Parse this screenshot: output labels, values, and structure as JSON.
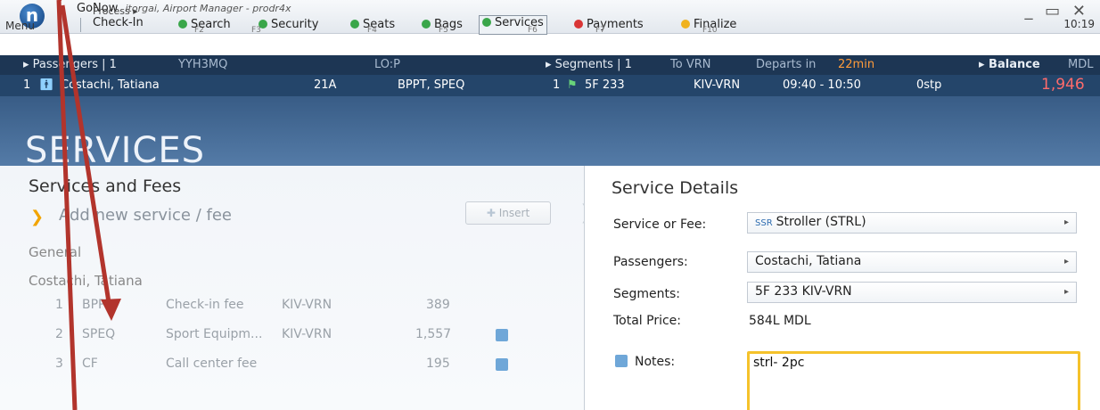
{
  "window": {
    "logo_letter": "n",
    "menu_label": "Menu",
    "app_name": "GoNow",
    "app_sub": "itorgai, Airport Manager - prodr4x",
    "process_label": "Process ▸",
    "current_mode": "Check-In",
    "mode_key": "F2",
    "controls": "_ ▭ ✕",
    "clock": "10:19"
  },
  "steps": [
    {
      "label": "Search",
      "key": "F3",
      "color": "#3aa64a"
    },
    {
      "label": "Security",
      "key": "F4",
      "color": "#3aa64a"
    },
    {
      "label": "Seats",
      "key": "F5",
      "color": "#3aa64a"
    },
    {
      "label": "Bags",
      "key": "F6",
      "color": "#3aa64a"
    },
    {
      "label": "Services",
      "key": "F6",
      "color": "#3aa64a"
    },
    {
      "label": "Payments",
      "key": "F7",
      "color": "#d93535"
    },
    {
      "label": "Finalize",
      "key": "F10",
      "color": "#f0b21e"
    }
  ],
  "passengers_header": {
    "label": "▸ Passengers | 1",
    "pnr": "YYH3MQ",
    "lo": "LO:P"
  },
  "segments_header": {
    "label": "▸ Segments | 1",
    "to": "To VRN",
    "departs_prefix": "Departs in",
    "departs_value": "22min"
  },
  "balance_header": {
    "label": "▸ Balance",
    "currency": "MDL"
  },
  "passenger_row": {
    "index": "1",
    "name": "Costachi, Tatiana",
    "seat": "21A",
    "ssr": "BPPT, SPEQ",
    "seg_index": "1",
    "flight": "5F 233",
    "route": "KIV-VRN",
    "times": "09:40 - 10:50",
    "stops": "0stp",
    "balance": "1,946"
  },
  "section_title": "SERVICES",
  "left_panel": {
    "title": "Services and Fees",
    "add_placeholder": "Add new service / fee",
    "insert_label": "Insert",
    "group_general": "General",
    "group_passenger": "Costachi, Tatiana",
    "rows": [
      {
        "n": "1",
        "code": "BPPT",
        "desc": "Check-in fee",
        "route": "KIV-VRN",
        "amount": "389",
        "has_doc": false
      },
      {
        "n": "2",
        "code": "SPEQ",
        "desc": "Sport Equipm...",
        "route": "KIV-VRN",
        "amount": "1,557",
        "has_doc": true
      },
      {
        "n": "3",
        "code": "CF",
        "desc": "Call center fee",
        "route": "",
        "amount": "195",
        "has_doc": true
      }
    ]
  },
  "right_panel": {
    "title": "Service Details",
    "service_label": "Service or Fee:",
    "service_tag": "SSR",
    "service_value": "Stroller (STRL)",
    "passengers_label": "Passengers:",
    "passengers_value": "Costachi, Tatiana",
    "segments_label": "Segments:",
    "segments_value": "5F  233 KIV-VRN",
    "total_label": "Total Price:",
    "total_value": "584L MDL",
    "notes_label": "Notes:",
    "notes_value": "strl- 2pc"
  }
}
